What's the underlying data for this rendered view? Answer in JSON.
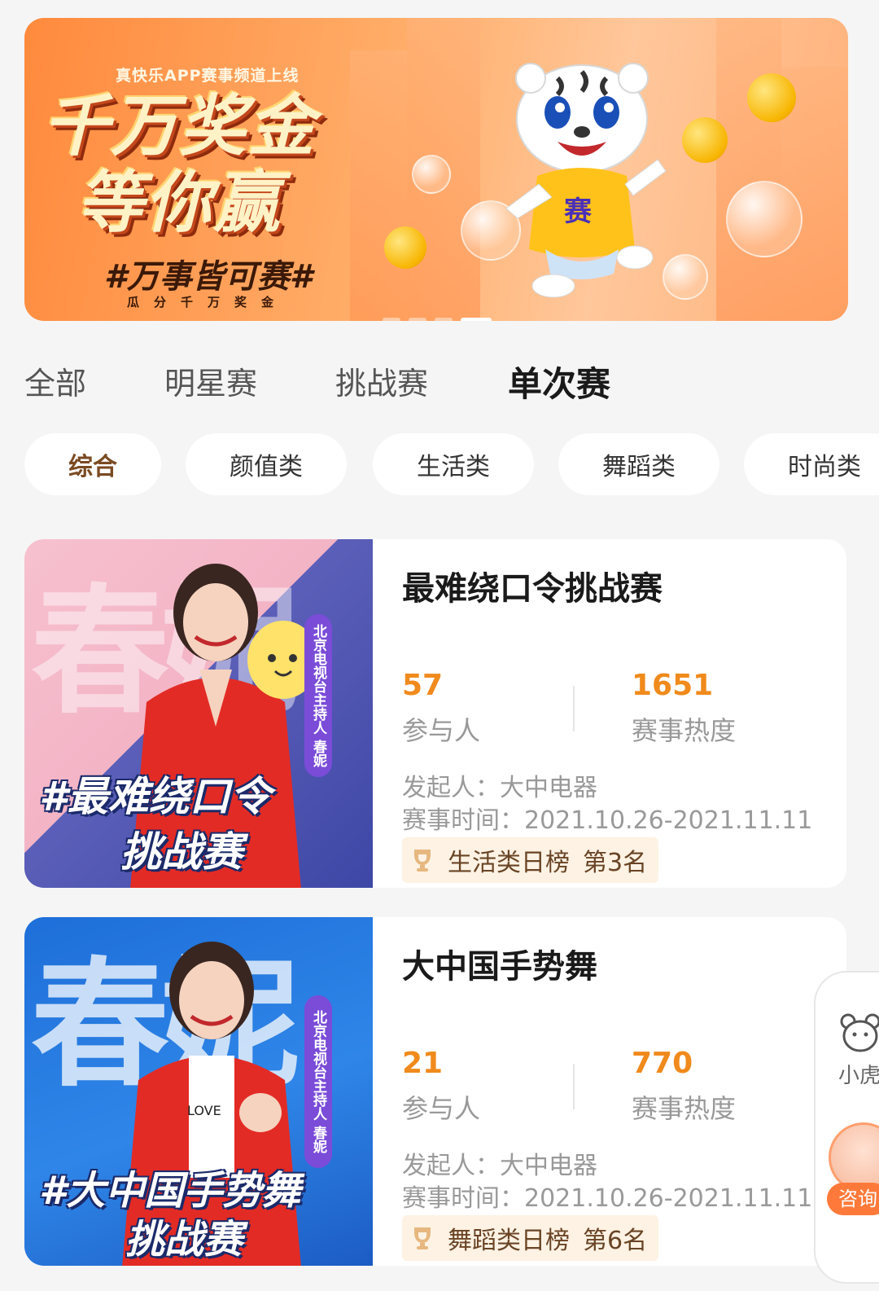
{
  "banner": {
    "eyebrow": "真快乐APP赛事频道上线",
    "headline_1": "千万奖金",
    "headline_2": "等你赢",
    "tagline": "#万事皆可赛#",
    "sub": "瓜分千万奖金",
    "mascot_shirt": "赛",
    "page_count": 4,
    "active_page": 3
  },
  "tabs": [
    {
      "label": "全部",
      "active": false
    },
    {
      "label": "明星赛",
      "active": false
    },
    {
      "label": "挑战赛",
      "active": false
    },
    {
      "label": "单次赛",
      "active": true
    }
  ],
  "chips": [
    {
      "label": "综合",
      "active": true
    },
    {
      "label": "颜值类",
      "active": false
    },
    {
      "label": "生活类",
      "active": false
    },
    {
      "label": "舞蹈类",
      "active": false
    },
    {
      "label": "时尚类",
      "active": false
    }
  ],
  "cards": [
    {
      "title": "最难绕口令挑战赛",
      "participants": "57",
      "participants_label": "参与人",
      "heat": "1651",
      "heat_label": "赛事热度",
      "organizer": "发起人：大中电器",
      "time": "赛事时间：2021.10.26-2021.11.11",
      "rank_board": "生活类日榜",
      "rank_pos": "第3名",
      "cover": {
        "bg_text": "春妮",
        "vertical_label": "北京电视台主持人 春妮",
        "line1": "#最难绕口令",
        "line2": "挑战赛"
      }
    },
    {
      "title": "大中国手势舞",
      "participants": "21",
      "participants_label": "参与人",
      "heat": "770",
      "heat_label": "赛事热度",
      "organizer": "发起人：大中电器",
      "time": "赛事时间：2021.10.26-2021.11.11",
      "rank_board": "舞蹈类日榜",
      "rank_pos": "第6名",
      "cover": {
        "bg_text": "春妮",
        "vertical_label": "北京电视台主持人 春妮",
        "shirt_text": "LOVE",
        "line1": "#大中国手势舞",
        "line2": "挑战赛"
      }
    }
  ],
  "float_panel": {
    "label": "小虎",
    "consult_label": "咨询"
  },
  "colors": {
    "accent_orange": "#f08a1c",
    "rank_bg": "#fdf2e4",
    "active_chip_text": "#7a4a22",
    "page_bg": "#f5f5f5"
  }
}
